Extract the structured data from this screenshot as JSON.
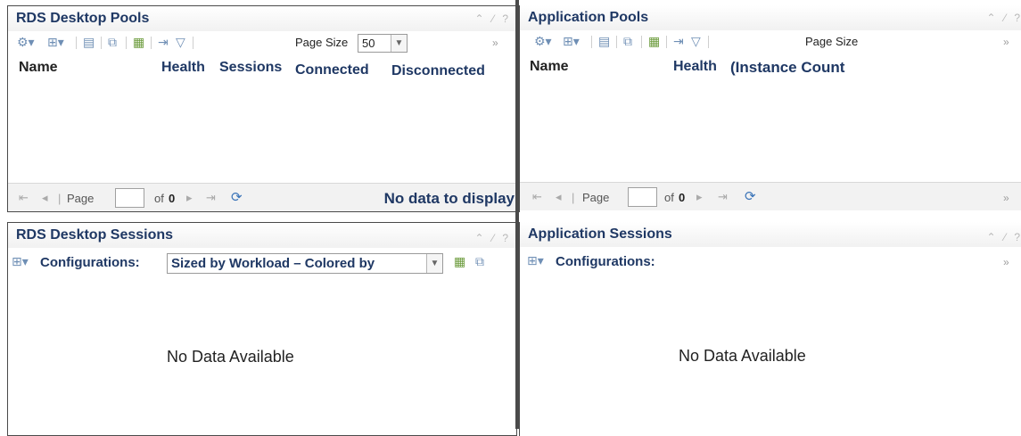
{
  "panels": {
    "rds_desktop_pools": {
      "title": "RDS Desktop Pools",
      "title_tools": "⌃ ⁄ ?",
      "toolbar": {
        "page_size_label": "Page Size",
        "page_size_value": "50",
        "more": "»"
      },
      "columns": [
        "Name",
        "Health",
        "Sessions",
        "Connected",
        "Disconnected"
      ],
      "footer": {
        "page_label": "Page",
        "of_label": "of",
        "of_value": "0",
        "status": "No data to display"
      }
    },
    "application_pools": {
      "title": "Application Pools",
      "title_tools": "⌃ ⁄ ?",
      "toolbar": {
        "page_size_label": "Page Size",
        "more": "»"
      },
      "columns": [
        "Name",
        "Health",
        "(Instance Count"
      ],
      "footer": {
        "page_label": "Page",
        "of_label": "of",
        "of_value": "0",
        "more": "»"
      }
    },
    "rds_desktop_sessions": {
      "title": "RDS Desktop Sessions",
      "title_tools": "⌃ ⁄ ?",
      "configurations_label": "Configurations:",
      "configurations_value": "Sized by Workload – Colored by",
      "message": "No Data Available"
    },
    "application_sessions": {
      "title": "Application Sessions",
      "title_tools": "⌃ ⁄ ?",
      "configurations_label": "Configurations:",
      "more": "»",
      "message": "No Data Available"
    }
  },
  "icons": {
    "actions": "gear-icon",
    "show_hide": "columns-icon",
    "export": "export-icon",
    "filter": "filter-icon",
    "refresh": "refresh-icon"
  }
}
